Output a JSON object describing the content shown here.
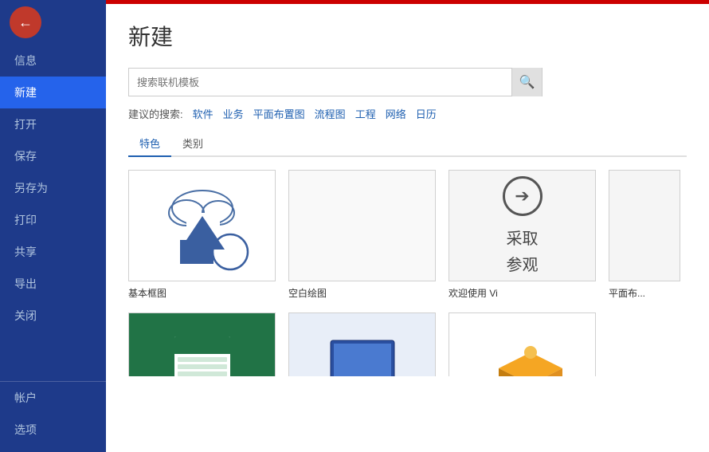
{
  "sidebar": {
    "back_label": "←",
    "items": [
      {
        "label": "信息",
        "id": "info",
        "active": false
      },
      {
        "label": "新建",
        "id": "new",
        "active": true
      },
      {
        "label": "打开",
        "id": "open",
        "active": false
      },
      {
        "label": "保存",
        "id": "save",
        "active": false
      },
      {
        "label": "另存为",
        "id": "saveas",
        "active": false
      },
      {
        "label": "打印",
        "id": "print",
        "active": false
      },
      {
        "label": "共享",
        "id": "share",
        "active": false
      },
      {
        "label": "导出",
        "id": "export",
        "active": false
      },
      {
        "label": "关闭",
        "id": "close",
        "active": false
      }
    ],
    "bottom_items": [
      {
        "label": "帐户",
        "id": "account"
      },
      {
        "label": "选项",
        "id": "options"
      }
    ]
  },
  "main": {
    "page_title": "新建",
    "search": {
      "placeholder": "搜索联机模板",
      "button_icon": "🔍"
    },
    "suggest": {
      "label": "建议的搜索:",
      "tags": [
        "软件",
        "业务",
        "平面布置图",
        "流程图",
        "工程",
        "网络",
        "日历"
      ]
    },
    "filter_tabs": [
      {
        "label": "特色",
        "active": true
      },
      {
        "label": "类别",
        "active": false
      }
    ],
    "templates": [
      {
        "id": "basic",
        "label": "基本框图",
        "type": "shapes"
      },
      {
        "id": "blank",
        "label": "空白绘图",
        "type": "blank"
      },
      {
        "id": "welcome",
        "label": "欢迎使用 Vi",
        "type": "welcome"
      },
      {
        "id": "flat",
        "label": "平面布...",
        "type": "flat_partial"
      }
    ],
    "templates_bottom": [
      {
        "id": "green",
        "label": "",
        "type": "green"
      },
      {
        "id": "laptop",
        "label": "",
        "type": "laptop"
      },
      {
        "id": "orange",
        "label": "",
        "type": "orange"
      }
    ]
  }
}
